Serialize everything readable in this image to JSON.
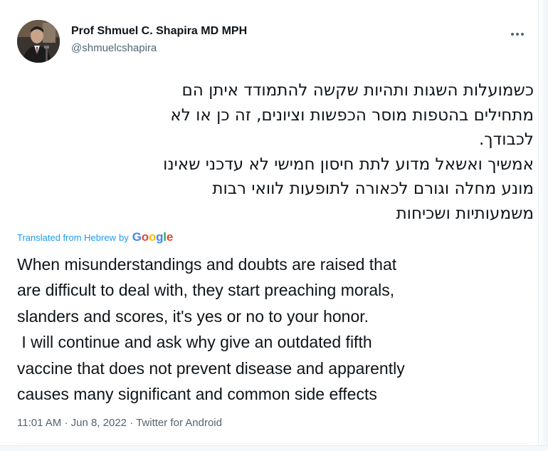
{
  "author": {
    "display_name": "Prof Shmuel C. Shapira MD MPH",
    "handle": "@shmuelcshapira",
    "avatar_icon": "person-avatar-icon"
  },
  "tweet": {
    "hebrew_lines": [
      "כשמועלות השגות ותהיות שקשה להתמודד איתן הם",
      "מתחילים בהטפות מוסר הכפשות וציונים, זה כן או לא",
      "לכבודך.",
      "אמשיך ואשאל מדוע לתת חיסון חמישי לא עדכני שאינו",
      "מונע מחלה וגורם לכאורה לתופעות לוואי רבות",
      "משמעותיות ושכיחות"
    ],
    "translated_from": "Translated from Hebrew",
    "translated_by": "by",
    "translator_logo_letters": [
      "G",
      "o",
      "o",
      "g",
      "l",
      "e"
    ],
    "translation_lines": [
      "When misunderstandings and doubts are raised that",
      "are difficult to deal with, they start preaching morals,",
      "slanders and scores, it's yes or no to your honor.",
      " I will continue and ask why give an outdated fifth",
      "vaccine that does not prevent disease and apparently",
      "causes many significant and common side effects"
    ],
    "time": "11:01 AM",
    "separator": "·",
    "date": "Jun 8, 2022",
    "source": "Twitter for Android"
  },
  "colors": {
    "text": "#0f1419",
    "secondary": "#536471",
    "link": "#1d9bf0",
    "google_blue": "#4285f4",
    "google_red": "#ea4335",
    "google_yellow": "#fbbc05",
    "google_green": "#34a853"
  },
  "icons": {
    "more": "more-horizontal-icon"
  }
}
